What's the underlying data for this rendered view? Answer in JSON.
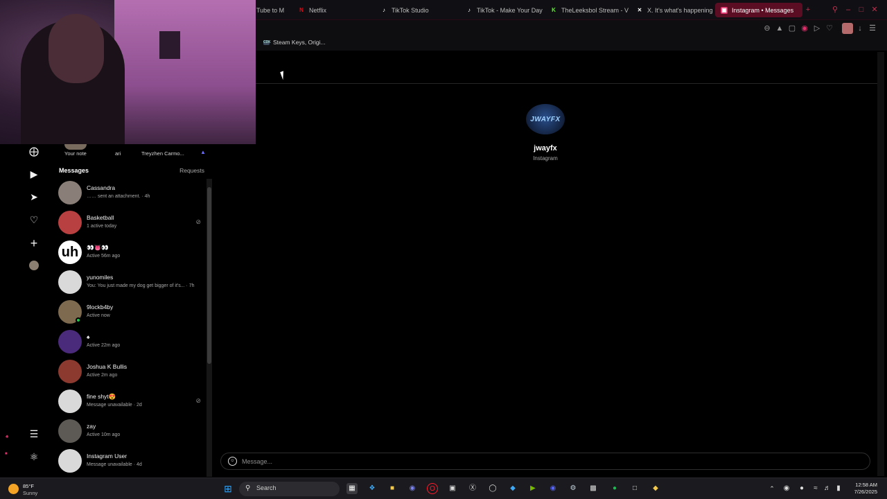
{
  "browser": {
    "tabs": [
      {
        "label": "Tube to M",
        "icon": "youtube-favicon-icon",
        "color": "#ff0000"
      },
      {
        "label": "Netflix",
        "icon": "netflix-favicon-icon",
        "color": "#e50914"
      },
      {
        "label": "TikTok Studio",
        "icon": "tiktok-favicon-icon",
        "color": "#ffffff"
      },
      {
        "label": "TikTok - Make Your Day",
        "icon": "tiktok-favicon-icon",
        "color": "#ffffff"
      },
      {
        "label": "TheLeeksbol Stream - V",
        "icon": "kick-favicon-icon",
        "color": "#53fc18"
      },
      {
        "label": "X. It's what's happening",
        "icon": "x-favicon-icon",
        "color": "#ffffff"
      },
      {
        "label": "Instagram • Messages",
        "icon": "instagram-favicon-icon",
        "color": "#e1306c"
      }
    ],
    "active_tab_index": 6,
    "bookmark": {
      "label": "Steam Keys, Origi...",
      "icon_text": "CDK"
    }
  },
  "notes": {
    "your_note": "Your note",
    "note2": "ari",
    "note3": "Treyzhen Carmo..."
  },
  "messages": {
    "title": "Messages",
    "requests": "Requests",
    "conversations": [
      {
        "name": "Cassandra",
        "sub": "…… sent an attachment. · 4h",
        "avatar_color": "#8a7f78",
        "muted": false,
        "online": false
      },
      {
        "name": "Basketball",
        "sub": "1 active today",
        "avatar_color": "#b84040",
        "muted": true,
        "online": false
      },
      {
        "name": "👀👅👀",
        "sub": "Active 56m ago",
        "avatar_color": "#ffffff",
        "avatar_text": "uh",
        "muted": false,
        "online": false
      },
      {
        "name": "yunomiles",
        "sub": "You: You just made my dog get bigger of it's... · 7h",
        "avatar_color": "#d9d9d9",
        "muted": false,
        "online": false
      },
      {
        "name": "9lockb4by",
        "sub": "Active now",
        "avatar_color": "#7d6a4f",
        "muted": false,
        "online": true
      },
      {
        "name": "♠",
        "sub": "Active 22m ago",
        "avatar_color": "#4a2a7a",
        "muted": false,
        "online": false
      },
      {
        "name": "Joshua K Bullis",
        "sub": "Active 2m ago",
        "avatar_color": "#8c3a2f",
        "muted": false,
        "online": false
      },
      {
        "name": "fine shyt😍",
        "sub": "Message unavailable · 2d",
        "avatar_color": "#d9d9d9",
        "muted": true,
        "online": false
      },
      {
        "name": "zay",
        "sub": "Active 10m ago",
        "avatar_color": "#5d5a55",
        "muted": false,
        "online": false
      },
      {
        "name": "Instagram User",
        "sub": "Message unavailable · 4d",
        "avatar_color": "#d9d9d9",
        "muted": false,
        "online": false
      }
    ]
  },
  "chat": {
    "name": "jwayfx",
    "subtitle": "Instagram",
    "avatar_text": "JWAYFX",
    "input_placeholder": "Message..."
  },
  "taskbar": {
    "weather_temp": "85°F",
    "weather_cond": "Sunny",
    "search_label": "Search",
    "time": "12:58 AM",
    "date": "7/26/2025"
  },
  "colors": {
    "accent": "#e1306c",
    "active_tab_bg": "#5a0d23",
    "online_green": "#1ec746"
  }
}
